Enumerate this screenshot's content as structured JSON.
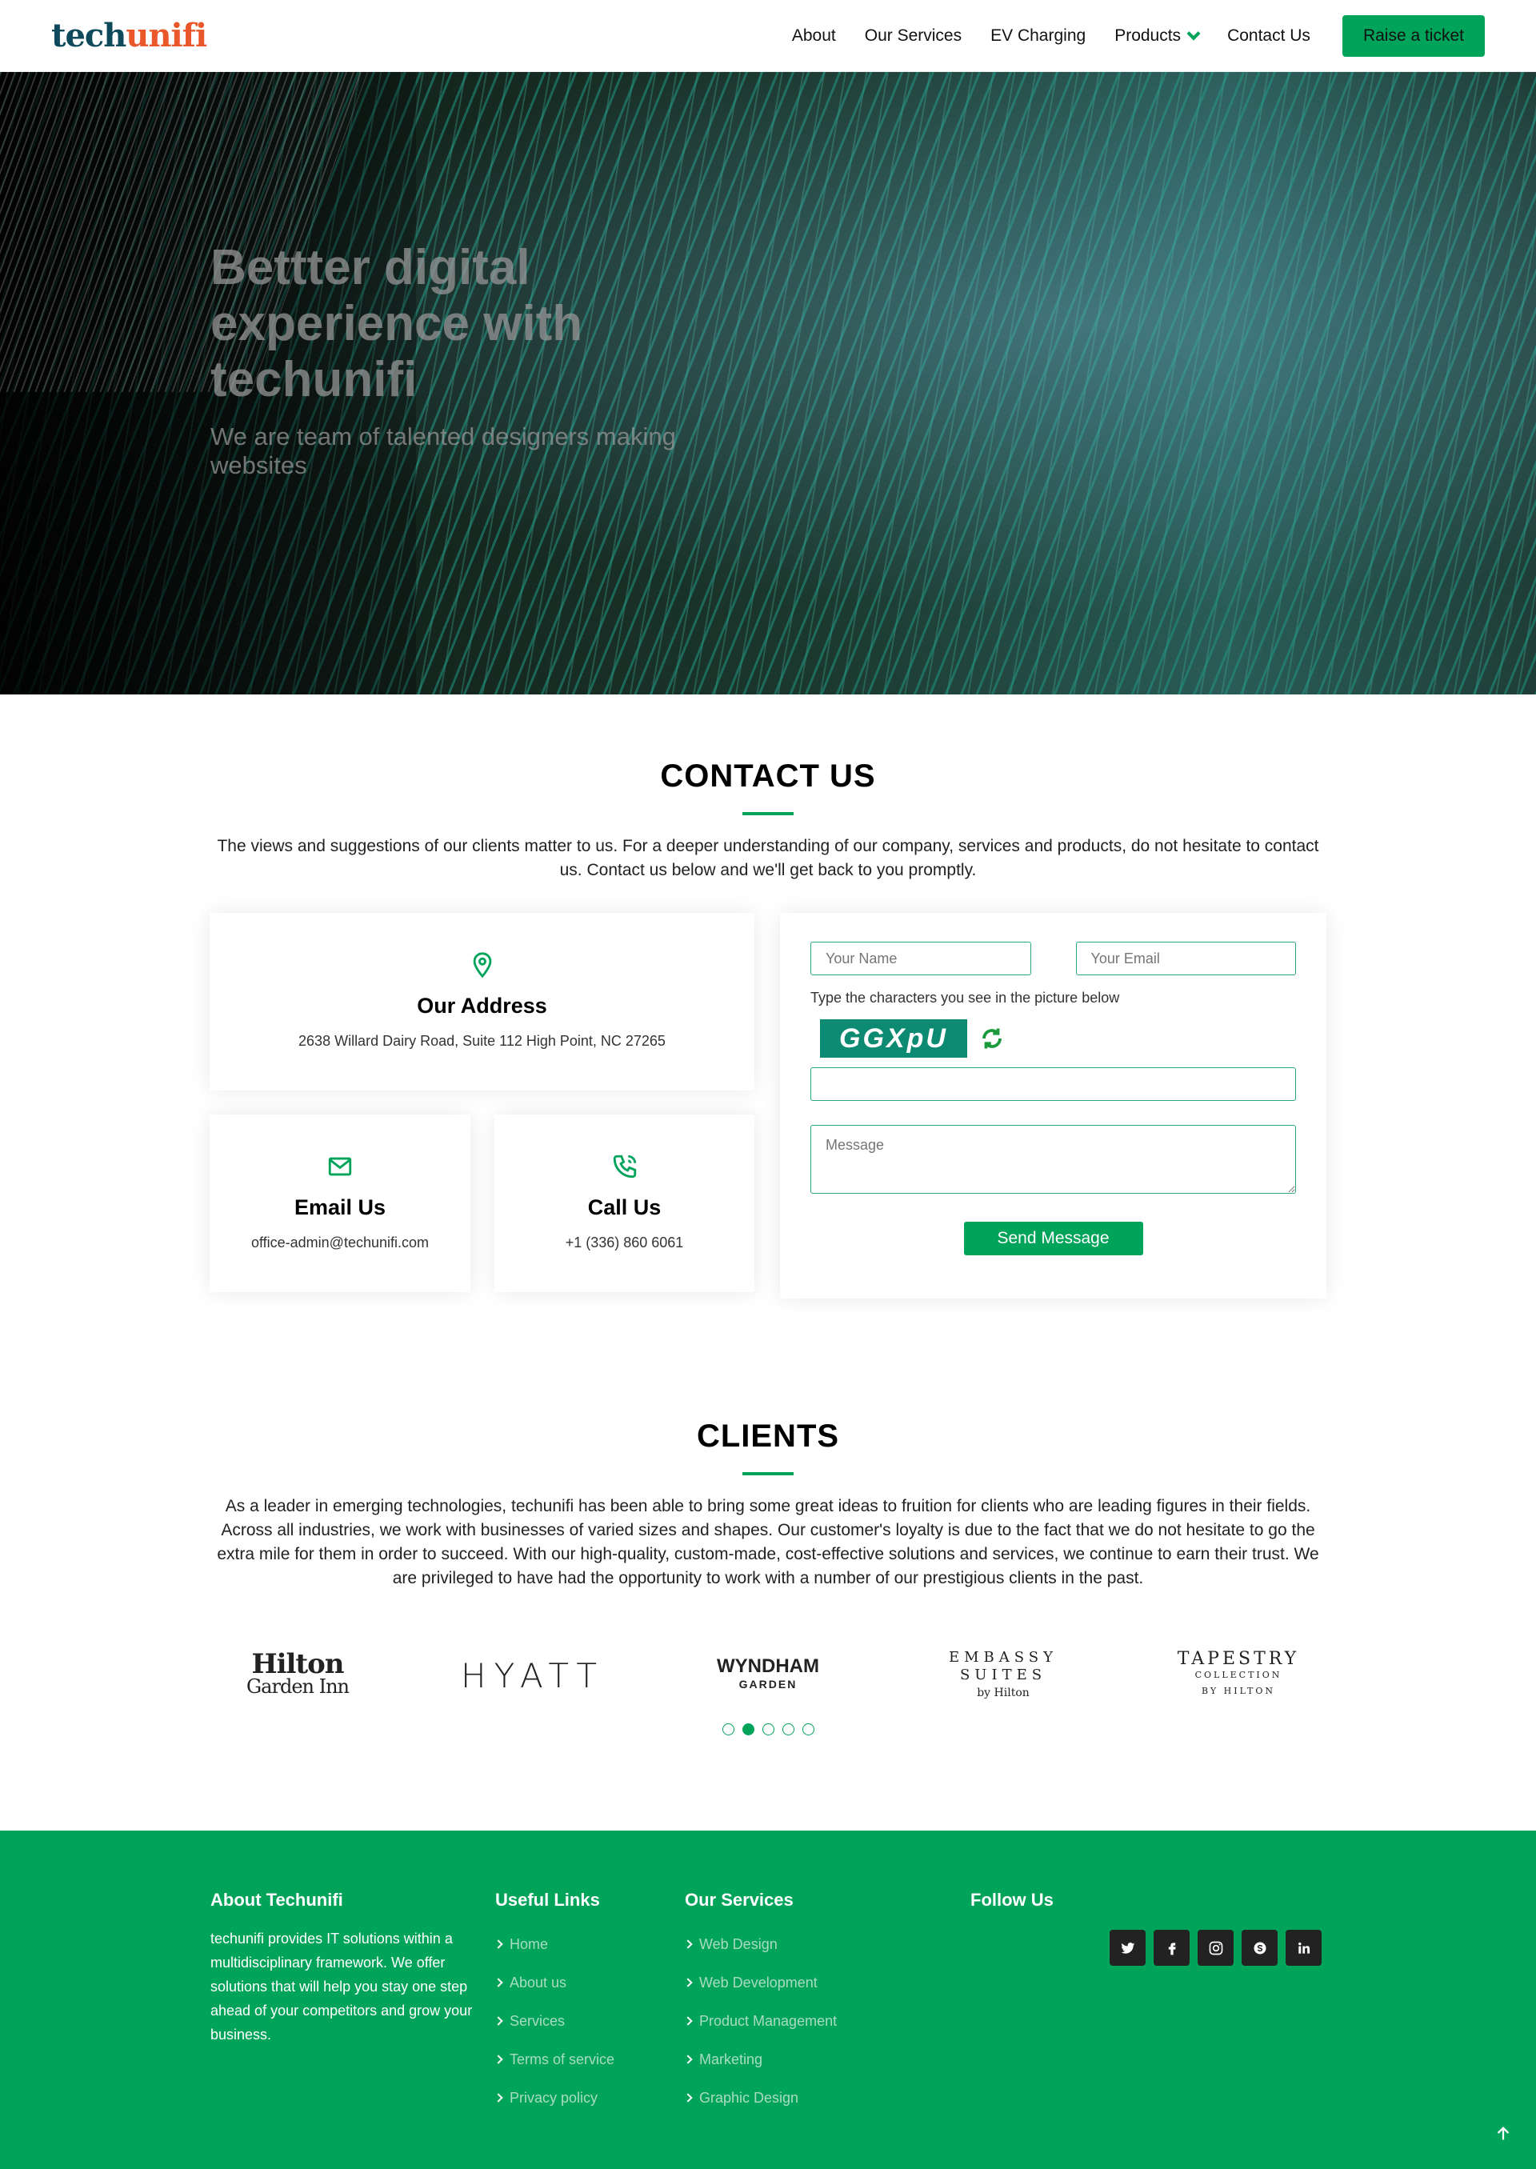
{
  "header": {
    "logo_part1": "tech",
    "logo_part2": "unifi",
    "nav": [
      "About",
      "Our Services",
      "EV Charging",
      "Products",
      "Contact Us"
    ],
    "cta": "Raise a ticket"
  },
  "hero": {
    "title": "Bettter digital experience with techunifi",
    "subtitle": "We are team of talented designers making websites"
  },
  "contact": {
    "title": "CONTACT US",
    "description": "The views and suggestions of our clients matter to us. For a deeper understanding of our company, services and products, do not hesitate to contact us. Contact us below and we'll get back to you promptly.",
    "address_title": "Our Address",
    "address": "2638 Willard Dairy Road, Suite 112 High Point, NC 27265",
    "email_title": "Email Us",
    "email": "office-admin@techunifi.com",
    "call_title": "Call Us",
    "phone": "+1 (336) 860 6061",
    "form": {
      "name_placeholder": "Your Name",
      "email_placeholder": "Your Email",
      "captcha_label": "Type the characters you see in the picture below",
      "captcha_text": "GGXpU",
      "message_placeholder": "Message",
      "send_label": "Send Message"
    }
  },
  "clients": {
    "title": "CLIENTS",
    "description": "As a leader in emerging technologies, techunifi has been able to bring some great ideas to fruition for clients who are leading figures in their fields. Across all industries, we work with businesses of varied sizes and shapes. Our customer's loyalty is due to the fact that we do not hesitate to go the extra mile for them in order to succeed. With our high-quality, custom-made, cost-effective solutions and services, we continue to earn their trust. We are privileged to have had the opportunity to work with a number of our prestigious clients in the past.",
    "logos": {
      "hilton_1": "Hilton",
      "hilton_2": "Garden Inn",
      "hyatt": "HYATT",
      "wyndham_1": "WYNDHAM",
      "wyndham_2": "GARDEN",
      "embassy_1": "EMBASSY",
      "embassy_2": "SUITES",
      "embassy_3": "by Hilton",
      "tapestry_1": "TAPESTRY",
      "tapestry_2": "COLLECTION",
      "tapestry_3": "BY HILTON"
    },
    "carousel_active_index": 1,
    "carousel_count": 5
  },
  "footer": {
    "about_title": "About Techunifi",
    "about_text": "techunifi provides IT solutions within a multidisciplinary framework. We offer solutions that will help you stay one step ahead of your competitors and grow your business.",
    "links_title": "Useful Links",
    "links": [
      "Home",
      "About us",
      "Services",
      "Terms of service",
      "Privacy policy"
    ],
    "services_title": "Our Services",
    "services": [
      "Web Design",
      "Web Development",
      "Product Management",
      "Marketing",
      "Graphic Design"
    ],
    "follow_title": "Follow Us",
    "social_icons": [
      "twitter-icon",
      "facebook-icon",
      "instagram-icon",
      "skype-icon",
      "linkedin-icon"
    ]
  },
  "colors": {
    "accent": "#00a35a",
    "logo_dark": "#0e4a5c",
    "logo_orange": "#e9572b"
  }
}
